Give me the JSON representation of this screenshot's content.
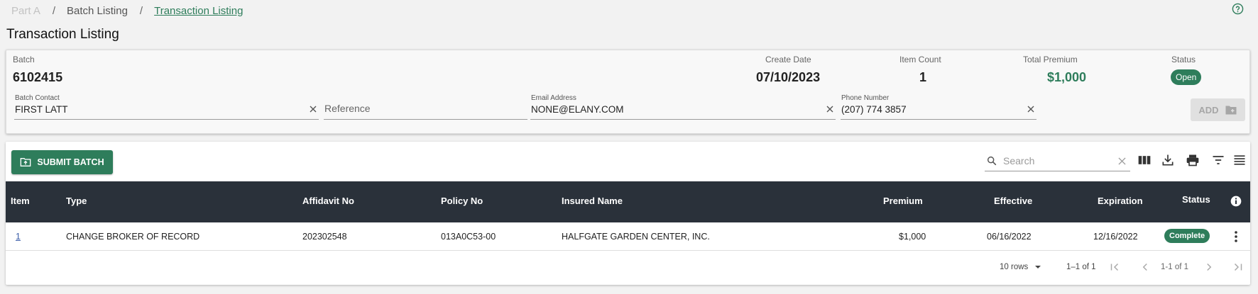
{
  "breadcrumb": {
    "items": [
      "Part A",
      "Batch Listing",
      "Transaction Listing"
    ],
    "separator": "/"
  },
  "help_icon": "help-circle-icon",
  "page_title": "Transaction Listing",
  "batch_summary": {
    "batch_label": "Batch",
    "batch_value": "6102415",
    "create_date_label": "Create Date",
    "create_date_value": "07/10/2023",
    "item_count_label": "Item Count",
    "item_count_value": "1",
    "total_premium_label": "Total Premium",
    "total_premium_value": "$1,000",
    "status_label": "Status",
    "status_value": "Open"
  },
  "batch_form": {
    "contact_label": "Batch Contact",
    "contact_value": "FIRST LATT",
    "reference_placeholder": "Reference",
    "email_label": "Email Address",
    "email_value": "NONE@ELANY.COM",
    "phone_label": "Phone Number",
    "phone_value": "(207) 774 3857",
    "add_label": "ADD"
  },
  "toolbar": {
    "submit_label": "SUBMIT BATCH",
    "search_placeholder": "Search",
    "icons": [
      "columns-icon",
      "download-icon",
      "print-icon",
      "filter-icon",
      "density-icon"
    ]
  },
  "table": {
    "columns": [
      "Item",
      "Type",
      "Affidavit No",
      "Policy No",
      "Insured Name",
      "Premium",
      "Effective",
      "Expiration",
      "Status"
    ],
    "rows": [
      {
        "item": "1",
        "type": "CHANGE BROKER OF RECORD",
        "affidavit_no": "202302548",
        "policy_no": "013A0C53-00",
        "insured_name": "HALFGATE GARDEN CENTER, INC.",
        "premium": "$1,000",
        "effective": "06/16/2022",
        "expiration": "12/16/2022",
        "status": "Complete"
      }
    ]
  },
  "pagination": {
    "rows_per_page": "10 rows",
    "range": "1–1 of 1",
    "page_info": "1-1 of 1"
  },
  "colors": {
    "accent": "#2e7d5b",
    "header_bg": "#2a313a",
    "link": "#3a5ca8"
  }
}
